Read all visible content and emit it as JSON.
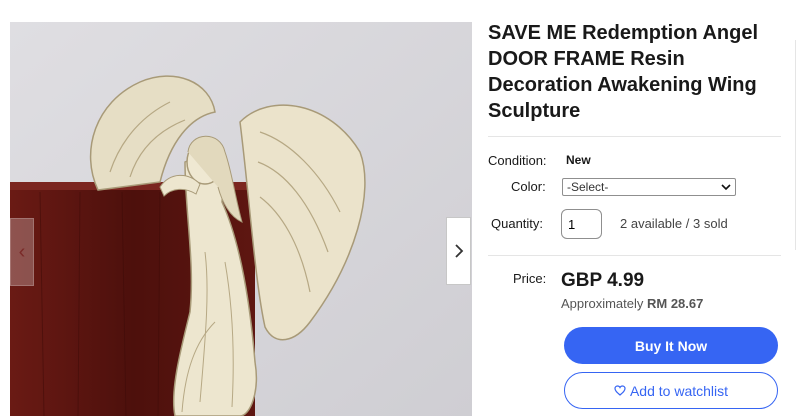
{
  "listing": {
    "title": "SAVE ME Redemption Angel DOOR FRAME Resin Decoration Awakening Wing Sculpture",
    "condition_label": "Condition:",
    "condition_value": "New",
    "color_label": "Color:",
    "color_select_value": "-Select-",
    "quantity_label": "Quantity:",
    "quantity_value": "1",
    "availability": "2 available / 3 sold",
    "price_label": "Price:",
    "price": "GBP 4.99",
    "approx_prefix": "Approximately",
    "approx_value": "RM 28.67",
    "buy_now_label": "Buy It Now",
    "watchlist_label": "Add to watchlist"
  },
  "gallery": {
    "prev_icon": "chevron-left-icon",
    "next_icon": "chevron-right-icon"
  },
  "colors": {
    "accent": "#3665f3",
    "door": "#5a1410",
    "background": "#d9d8dc",
    "sculpture": "#e8e0c8"
  }
}
